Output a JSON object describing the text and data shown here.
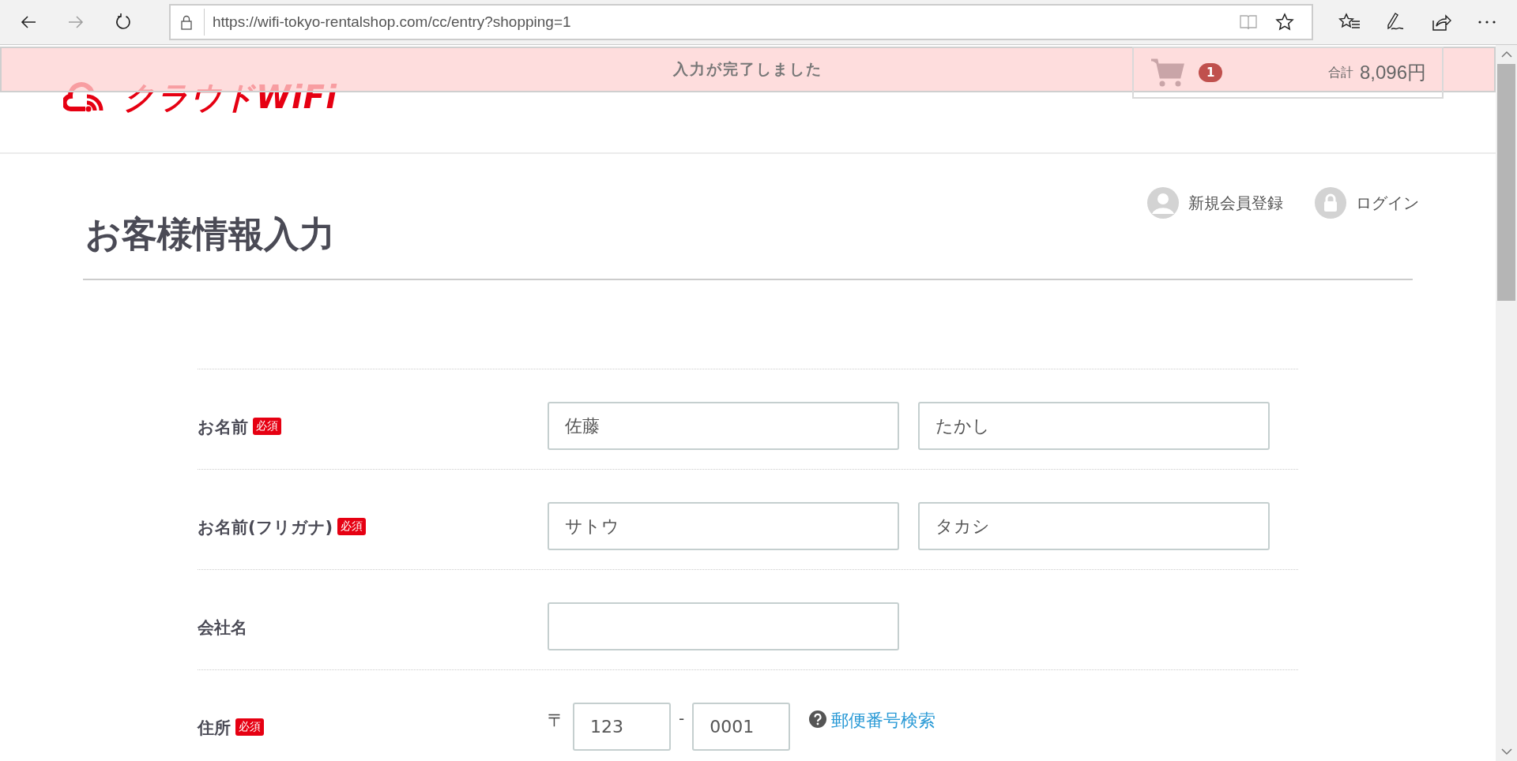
{
  "browser": {
    "url": "https://wifi-tokyo-rentalshop.com/cc/entry?shopping=1",
    "back_disabled": false,
    "forward_disabled": true
  },
  "toast": {
    "message": "入力が完了しました"
  },
  "header": {
    "logo_text": "クラウドWiFi",
    "cart": {
      "count": "1",
      "total_label": "合計",
      "total": "8,096円"
    }
  },
  "member_links": [
    {
      "kind": "register",
      "label": "新規会員登録"
    },
    {
      "kind": "login",
      "label": "ログイン"
    }
  ],
  "page_title": "お客様情報入力",
  "form_rows": [
    {
      "kind": "pair",
      "label": "お名前",
      "required": true,
      "required_badge": "必須",
      "fields": [
        {
          "value": "佐藤"
        },
        {
          "value": "たかし"
        }
      ]
    },
    {
      "kind": "pair",
      "label": "お名前(フリガナ)",
      "required": true,
      "required_badge": "必須",
      "fields": [
        {
          "value": "サトウ"
        },
        {
          "value": "タカシ"
        }
      ]
    },
    {
      "kind": "single",
      "label": "会社名",
      "required": false
    },
    {
      "kind": "postal",
      "label": "住所",
      "required": true,
      "required_badge": "必須",
      "postal_mark": "〒",
      "separator": "-",
      "fields": [
        {
          "value": "123"
        },
        {
          "value": "0001"
        }
      ],
      "lookup_link": "郵便番号検索"
    }
  ]
}
